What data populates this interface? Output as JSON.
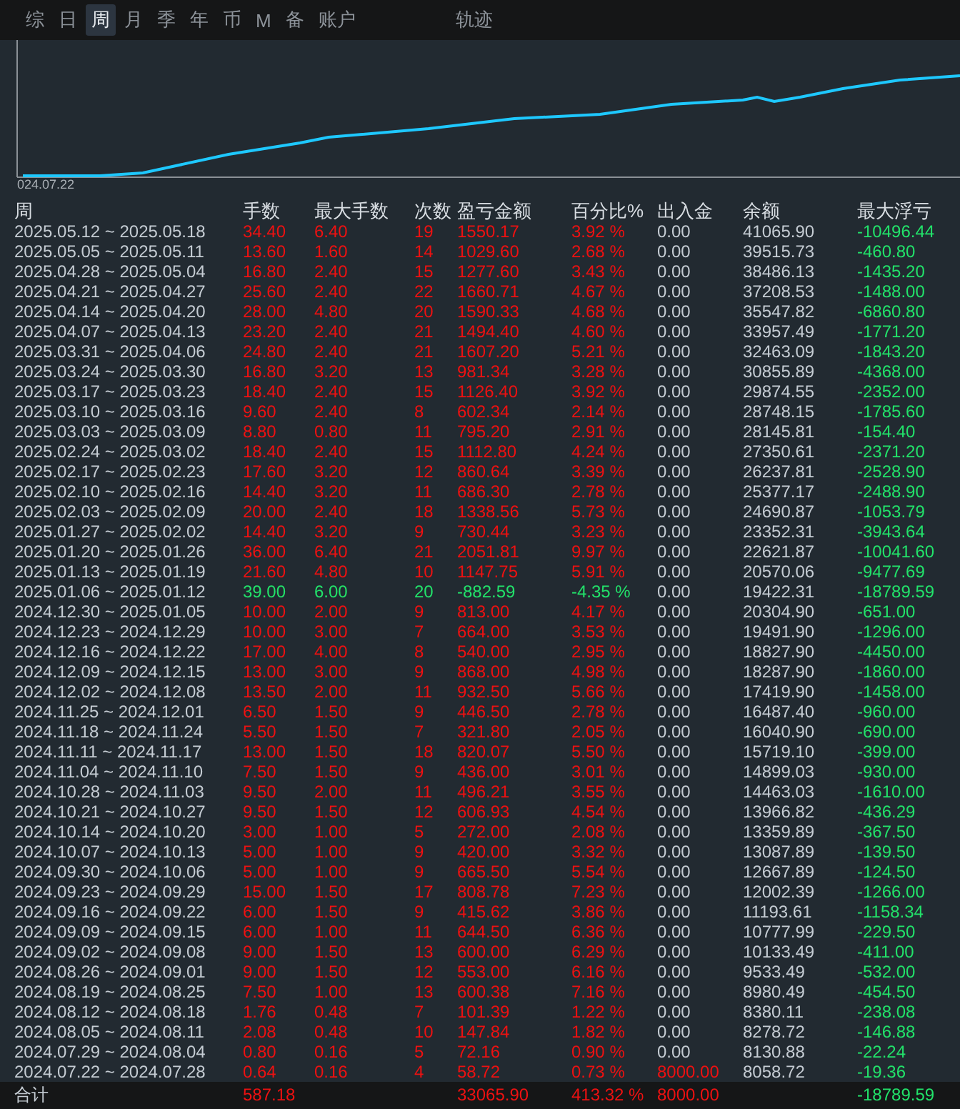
{
  "tabs": [
    {
      "label": "综",
      "selected": false
    },
    {
      "label": "日",
      "selected": false
    },
    {
      "label": "周",
      "selected": true
    },
    {
      "label": "月",
      "selected": false
    },
    {
      "label": "季",
      "selected": false
    },
    {
      "label": "年",
      "selected": false
    },
    {
      "label": "币",
      "selected": false
    },
    {
      "label": "M",
      "selected": false
    },
    {
      "label": "备",
      "selected": false
    },
    {
      "label": "账户",
      "selected": false
    }
  ],
  "track_tab": {
    "label": "轨迹",
    "selected": false
  },
  "chart": {
    "start_label": "024.07.22"
  },
  "table": {
    "columns": [
      "周",
      "手数",
      "最大手数",
      "次数",
      "盈亏金额",
      "百分比%",
      "出入金",
      "余额",
      "最大浮亏"
    ],
    "rows": [
      {
        "kind": "gain",
        "deposit_highlighted": false,
        "cells": [
          "2025.05.12 ~ 2025.05.18",
          "34.40",
          "6.40",
          "19",
          "1550.17",
          "3.92 %",
          "0.00",
          "41065.90",
          "-10496.44"
        ]
      },
      {
        "kind": "gain",
        "deposit_highlighted": false,
        "cells": [
          "2025.05.05 ~ 2025.05.11",
          "13.60",
          "1.60",
          "14",
          "1029.60",
          "2.68 %",
          "0.00",
          "39515.73",
          "-460.80"
        ]
      },
      {
        "kind": "gain",
        "deposit_highlighted": false,
        "cells": [
          "2025.04.28 ~ 2025.05.04",
          "16.80",
          "2.40",
          "15",
          "1277.60",
          "3.43 %",
          "0.00",
          "38486.13",
          "-1435.20"
        ]
      },
      {
        "kind": "gain",
        "deposit_highlighted": false,
        "cells": [
          "2025.04.21 ~ 2025.04.27",
          "25.60",
          "2.40",
          "22",
          "1660.71",
          "4.67 %",
          "0.00",
          "37208.53",
          "-1488.00"
        ]
      },
      {
        "kind": "gain",
        "deposit_highlighted": false,
        "cells": [
          "2025.04.14 ~ 2025.04.20",
          "28.00",
          "4.80",
          "20",
          "1590.33",
          "4.68 %",
          "0.00",
          "35547.82",
          "-6860.80"
        ]
      },
      {
        "kind": "gain",
        "deposit_highlighted": false,
        "cells": [
          "2025.04.07 ~ 2025.04.13",
          "23.20",
          "2.40",
          "21",
          "1494.40",
          "4.60 %",
          "0.00",
          "33957.49",
          "-1771.20"
        ]
      },
      {
        "kind": "gain",
        "deposit_highlighted": false,
        "cells": [
          "2025.03.31 ~ 2025.04.06",
          "24.80",
          "2.40",
          "21",
          "1607.20",
          "5.21 %",
          "0.00",
          "32463.09",
          "-1843.20"
        ]
      },
      {
        "kind": "gain",
        "deposit_highlighted": false,
        "cells": [
          "2025.03.24 ~ 2025.03.30",
          "16.80",
          "3.20",
          "13",
          "981.34",
          "3.28 %",
          "0.00",
          "30855.89",
          "-4368.00"
        ]
      },
      {
        "kind": "gain",
        "deposit_highlighted": false,
        "cells": [
          "2025.03.17 ~ 2025.03.23",
          "18.40",
          "2.40",
          "15",
          "1126.40",
          "3.92 %",
          "0.00",
          "29874.55",
          "-2352.00"
        ]
      },
      {
        "kind": "gain",
        "deposit_highlighted": false,
        "cells": [
          "2025.03.10 ~ 2025.03.16",
          "9.60",
          "2.40",
          "8",
          "602.34",
          "2.14 %",
          "0.00",
          "28748.15",
          "-1785.60"
        ]
      },
      {
        "kind": "gain",
        "deposit_highlighted": false,
        "cells": [
          "2025.03.03 ~ 2025.03.09",
          "8.80",
          "0.80",
          "11",
          "795.20",
          "2.91 %",
          "0.00",
          "28145.81",
          "-154.40"
        ]
      },
      {
        "kind": "gain",
        "deposit_highlighted": false,
        "cells": [
          "2025.02.24 ~ 2025.03.02",
          "18.40",
          "2.40",
          "15",
          "1112.80",
          "4.24 %",
          "0.00",
          "27350.61",
          "-2371.20"
        ]
      },
      {
        "kind": "gain",
        "deposit_highlighted": false,
        "cells": [
          "2025.02.17 ~ 2025.02.23",
          "17.60",
          "3.20",
          "12",
          "860.64",
          "3.39 %",
          "0.00",
          "26237.81",
          "-2528.90"
        ]
      },
      {
        "kind": "gain",
        "deposit_highlighted": false,
        "cells": [
          "2025.02.10 ~ 2025.02.16",
          "14.40",
          "3.20",
          "11",
          "686.30",
          "2.78 %",
          "0.00",
          "25377.17",
          "-2488.90"
        ]
      },
      {
        "kind": "gain",
        "deposit_highlighted": false,
        "cells": [
          "2025.02.03 ~ 2025.02.09",
          "20.00",
          "2.40",
          "18",
          "1338.56",
          "5.73 %",
          "0.00",
          "24690.87",
          "-1053.79"
        ]
      },
      {
        "kind": "gain",
        "deposit_highlighted": false,
        "cells": [
          "2025.01.27 ~ 2025.02.02",
          "14.40",
          "3.20",
          "9",
          "730.44",
          "3.23 %",
          "0.00",
          "23352.31",
          "-3943.64"
        ]
      },
      {
        "kind": "gain",
        "deposit_highlighted": false,
        "cells": [
          "2025.01.20 ~ 2025.01.26",
          "36.00",
          "6.40",
          "21",
          "2051.81",
          "9.97 %",
          "0.00",
          "22621.87",
          "-10041.60"
        ]
      },
      {
        "kind": "gain",
        "deposit_highlighted": false,
        "cells": [
          "2025.01.13 ~ 2025.01.19",
          "21.60",
          "4.80",
          "10",
          "1147.75",
          "5.91 %",
          "0.00",
          "20570.06",
          "-9477.69"
        ]
      },
      {
        "kind": "loss",
        "deposit_highlighted": false,
        "cells": [
          "2025.01.06 ~ 2025.01.12",
          "39.00",
          "6.00",
          "20",
          "-882.59",
          "-4.35 %",
          "0.00",
          "19422.31",
          "-18789.59"
        ]
      },
      {
        "kind": "gain",
        "deposit_highlighted": false,
        "cells": [
          "2024.12.30 ~ 2025.01.05",
          "10.00",
          "2.00",
          "9",
          "813.00",
          "4.17 %",
          "0.00",
          "20304.90",
          "-651.00"
        ]
      },
      {
        "kind": "gain",
        "deposit_highlighted": false,
        "cells": [
          "2024.12.23 ~ 2024.12.29",
          "10.00",
          "3.00",
          "7",
          "664.00",
          "3.53 %",
          "0.00",
          "19491.90",
          "-1296.00"
        ]
      },
      {
        "kind": "gain",
        "deposit_highlighted": false,
        "cells": [
          "2024.12.16 ~ 2024.12.22",
          "17.00",
          "4.00",
          "8",
          "540.00",
          "2.95 %",
          "0.00",
          "18827.90",
          "-4450.00"
        ]
      },
      {
        "kind": "gain",
        "deposit_highlighted": false,
        "cells": [
          "2024.12.09 ~ 2024.12.15",
          "13.00",
          "3.00",
          "9",
          "868.00",
          "4.98 %",
          "0.00",
          "18287.90",
          "-1860.00"
        ]
      },
      {
        "kind": "gain",
        "deposit_highlighted": false,
        "cells": [
          "2024.12.02 ~ 2024.12.08",
          "13.50",
          "2.00",
          "11",
          "932.50",
          "5.66 %",
          "0.00",
          "17419.90",
          "-1458.00"
        ]
      },
      {
        "kind": "gain",
        "deposit_highlighted": false,
        "cells": [
          "2024.11.25 ~ 2024.12.01",
          "6.50",
          "1.50",
          "9",
          "446.50",
          "2.78 %",
          "0.00",
          "16487.40",
          "-960.00"
        ]
      },
      {
        "kind": "gain",
        "deposit_highlighted": false,
        "cells": [
          "2024.11.18 ~ 2024.11.24",
          "5.50",
          "1.50",
          "7",
          "321.80",
          "2.05 %",
          "0.00",
          "16040.90",
          "-690.00"
        ]
      },
      {
        "kind": "gain",
        "deposit_highlighted": false,
        "cells": [
          "2024.11.11 ~ 2024.11.17",
          "13.00",
          "1.50",
          "18",
          "820.07",
          "5.50 %",
          "0.00",
          "15719.10",
          "-399.00"
        ]
      },
      {
        "kind": "gain",
        "deposit_highlighted": false,
        "cells": [
          "2024.11.04 ~ 2024.11.10",
          "7.50",
          "1.50",
          "9",
          "436.00",
          "3.01 %",
          "0.00",
          "14899.03",
          "-930.00"
        ]
      },
      {
        "kind": "gain",
        "deposit_highlighted": false,
        "cells": [
          "2024.10.28 ~ 2024.11.03",
          "9.50",
          "2.00",
          "11",
          "496.21",
          "3.55 %",
          "0.00",
          "14463.03",
          "-1610.00"
        ]
      },
      {
        "kind": "gain",
        "deposit_highlighted": false,
        "cells": [
          "2024.10.21 ~ 2024.10.27",
          "9.50",
          "1.50",
          "12",
          "606.93",
          "4.54 %",
          "0.00",
          "13966.82",
          "-436.29"
        ]
      },
      {
        "kind": "gain",
        "deposit_highlighted": false,
        "cells": [
          "2024.10.14 ~ 2024.10.20",
          "3.00",
          "1.00",
          "5",
          "272.00",
          "2.08 %",
          "0.00",
          "13359.89",
          "-367.50"
        ]
      },
      {
        "kind": "gain",
        "deposit_highlighted": false,
        "cells": [
          "2024.10.07 ~ 2024.10.13",
          "5.00",
          "1.00",
          "9",
          "420.00",
          "3.32 %",
          "0.00",
          "13087.89",
          "-139.50"
        ]
      },
      {
        "kind": "gain",
        "deposit_highlighted": false,
        "cells": [
          "2024.09.30 ~ 2024.10.06",
          "5.00",
          "1.00",
          "9",
          "665.50",
          "5.54 %",
          "0.00",
          "12667.89",
          "-124.50"
        ]
      },
      {
        "kind": "gain",
        "deposit_highlighted": false,
        "cells": [
          "2024.09.23 ~ 2024.09.29",
          "15.00",
          "1.50",
          "17",
          "808.78",
          "7.23 %",
          "0.00",
          "12002.39",
          "-1266.00"
        ]
      },
      {
        "kind": "gain",
        "deposit_highlighted": false,
        "cells": [
          "2024.09.16 ~ 2024.09.22",
          "6.00",
          "1.50",
          "9",
          "415.62",
          "3.86 %",
          "0.00",
          "11193.61",
          "-1158.34"
        ]
      },
      {
        "kind": "gain",
        "deposit_highlighted": false,
        "cells": [
          "2024.09.09 ~ 2024.09.15",
          "6.00",
          "1.00",
          "11",
          "644.50",
          "6.36 %",
          "0.00",
          "10777.99",
          "-229.50"
        ]
      },
      {
        "kind": "gain",
        "deposit_highlighted": false,
        "cells": [
          "2024.09.02 ~ 2024.09.08",
          "9.00",
          "1.50",
          "13",
          "600.00",
          "6.29 %",
          "0.00",
          "10133.49",
          "-411.00"
        ]
      },
      {
        "kind": "gain",
        "deposit_highlighted": false,
        "cells": [
          "2024.08.26 ~ 2024.09.01",
          "9.00",
          "1.50",
          "12",
          "553.00",
          "6.16 %",
          "0.00",
          "9533.49",
          "-532.00"
        ]
      },
      {
        "kind": "gain",
        "deposit_highlighted": false,
        "cells": [
          "2024.08.19 ~ 2024.08.25",
          "7.50",
          "1.00",
          "13",
          "600.38",
          "7.16 %",
          "0.00",
          "8980.49",
          "-454.50"
        ]
      },
      {
        "kind": "gain",
        "deposit_highlighted": false,
        "cells": [
          "2024.08.12 ~ 2024.08.18",
          "1.76",
          "0.48",
          "7",
          "101.39",
          "1.22 %",
          "0.00",
          "8380.11",
          "-238.08"
        ]
      },
      {
        "kind": "gain",
        "deposit_highlighted": false,
        "cells": [
          "2024.08.05 ~ 2024.08.11",
          "2.08",
          "0.48",
          "10",
          "147.84",
          "1.82 %",
          "0.00",
          "8278.72",
          "-146.88"
        ]
      },
      {
        "kind": "gain",
        "deposit_highlighted": false,
        "cells": [
          "2024.07.29 ~ 2024.08.04",
          "0.80",
          "0.16",
          "5",
          "72.16",
          "0.90 %",
          "0.00",
          "8130.88",
          "-22.24"
        ]
      },
      {
        "kind": "gain",
        "deposit_highlighted": true,
        "cells": [
          "2024.07.22 ~ 2024.07.28",
          "0.64",
          "0.16",
          "4",
          "58.72",
          "0.73 %",
          "8000.00",
          "8058.72",
          "-19.36"
        ]
      }
    ],
    "total": {
      "label": "合计",
      "lots": "587.18",
      "amount": "33065.90",
      "percent": "413.32 %",
      "deposit": "8000.00",
      "max_drawdown": "-18789.59"
    }
  }
}
